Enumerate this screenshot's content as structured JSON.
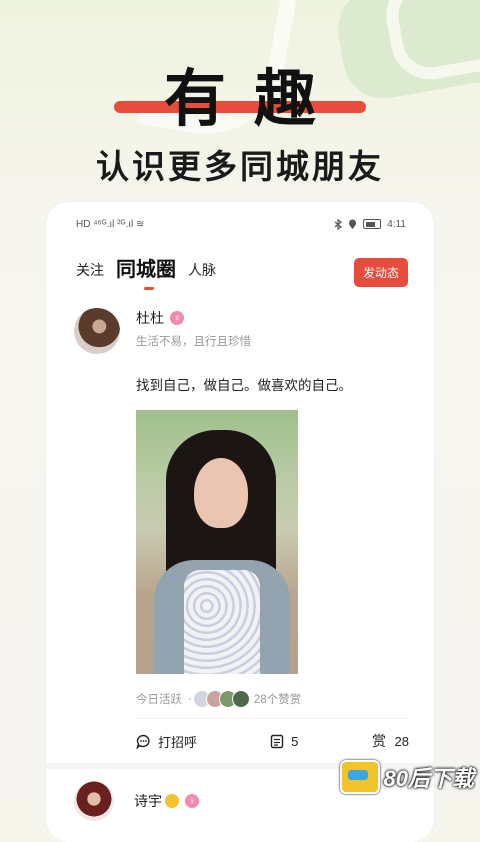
{
  "hero": {
    "title": "有趣",
    "subtitle": "认识更多同城朋友"
  },
  "status_bar": {
    "time": "4:11",
    "left_text": "HD ⁴⁶ᴳ.ıl ²ᴳ.ıl ≋"
  },
  "tabs": [
    {
      "label": "关注",
      "active": false
    },
    {
      "label": "同城圈",
      "active": true
    },
    {
      "label": "人脉",
      "active": false
    }
  ],
  "post_button": "发动态",
  "post": {
    "name": "杜杜",
    "gender": "♀",
    "signature": "生活不易，且行且珍惜",
    "content": "找到自己，做自己。做喜欢的自己。",
    "activity": "今日活跃",
    "separator": "·",
    "likes": "28个赞赏",
    "greet_label": "打招呼",
    "comment_count": "5",
    "reward_count": "28"
  },
  "post2": {
    "name": "诗宇",
    "gender": "♀"
  },
  "watermark": "80后下载",
  "colors": {
    "accent": "#e74c3c",
    "female_badge": "#f08bb0",
    "muted_text": "#999999"
  }
}
